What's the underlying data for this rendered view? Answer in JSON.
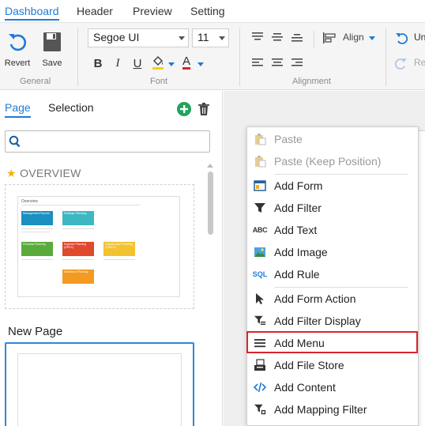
{
  "top_tabs": [
    "Dashboard",
    "Header",
    "Preview",
    "Setting"
  ],
  "ribbon": {
    "general": {
      "revert_label": "Revert",
      "save_label": "Save",
      "group_label": "General"
    },
    "font": {
      "family": "Segoe UI",
      "size": "11",
      "bold": "B",
      "italic": "I",
      "underline": "U",
      "font_color_glyph": "A",
      "group_label": "Font"
    },
    "alignment": {
      "align_label": "Align",
      "group_label": "Alignment"
    },
    "undo_label": "Un",
    "redo_label": "Re"
  },
  "left_panel": {
    "tabs": [
      "Page",
      "Selection"
    ],
    "overview_label": "OVERVIEW",
    "thumbnail": {
      "title": "Overview",
      "boxes": [
        "Management Reports",
        "Strategic Planning",
        "Financial Planning",
        "Expense Planning (OPEX)",
        "Capital Asset Planning (CAPEX)",
        "Workforce Planning"
      ]
    },
    "new_page_label": "New Page"
  },
  "context_menu": {
    "items": [
      {
        "label": "Paste",
        "icon": "paste-icon",
        "disabled": true
      },
      {
        "label": "Paste (Keep Position)",
        "icon": "paste-keep-icon",
        "disabled": true
      },
      {
        "label": "Add Form",
        "icon": "form-icon"
      },
      {
        "label": "Add Filter",
        "icon": "filter-icon"
      },
      {
        "label": "Add Text",
        "icon": "text-abc-icon",
        "glyph": "ABC"
      },
      {
        "label": "Add Image",
        "icon": "image-icon"
      },
      {
        "label": "Add Rule",
        "icon": "sql-icon",
        "glyph": "SQL"
      },
      {
        "label": "Add Form Action",
        "icon": "cursor-icon"
      },
      {
        "label": "Add Filter Display",
        "icon": "filter-display-icon"
      },
      {
        "label": "Add Menu",
        "icon": "menu-icon",
        "highlighted": true
      },
      {
        "label": "Add File Store",
        "icon": "file-store-icon"
      },
      {
        "label": "Add Content",
        "icon": "code-icon"
      },
      {
        "label": "Add Mapping Filter",
        "icon": "mapping-filter-icon"
      }
    ]
  },
  "colors": {
    "accent": "#1e7bd6",
    "highlight_border": "#d9262c",
    "add_green": "#21a35b",
    "thumb_blue": "#1b8fc0",
    "thumb_teal": "#3db7c4",
    "thumb_green": "#5bab3c",
    "thumb_red": "#e0492e",
    "thumb_yellow": "#f2c230",
    "thumb_orange": "#f39a22"
  }
}
